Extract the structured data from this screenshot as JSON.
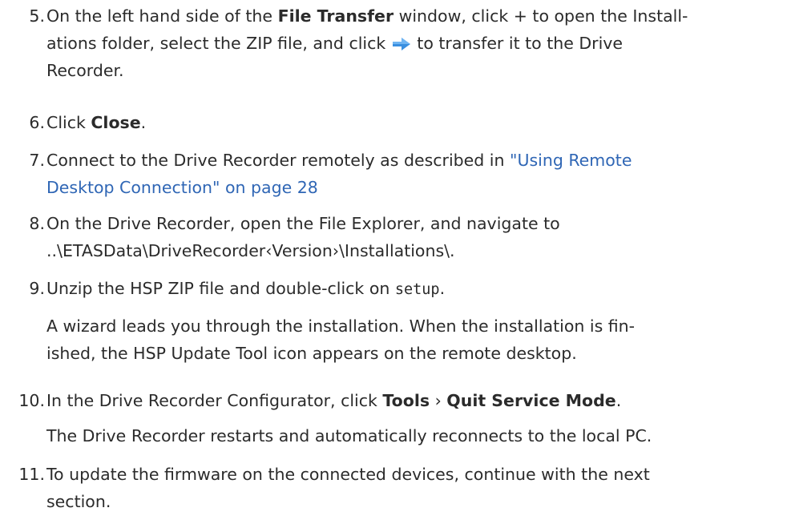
{
  "steps": [
    {
      "number": "5",
      "a": "On the left hand side of the ",
      "b": "File Transfer",
      "c": " window, click + to open the Install-",
      "d": "ations folder, select the ZIP file, and click ",
      "e": " to transfer it to the Drive",
      "f": "Recorder."
    },
    {
      "number": "6",
      "a": "Click ",
      "b": "Close",
      "c": "."
    },
    {
      "number": "7",
      "a": "Connect to the Drive Recorder remotely as described in ",
      "link1": "\"Using Remote",
      "link2": "Desktop Connection\" on page 28"
    },
    {
      "number": "8",
      "line1": "On the Drive Recorder, open the File Explorer, and navigate to",
      "line2": "..\\ETASData\\DriveRecorder‹Version›\\Installations\\."
    },
    {
      "number": "9",
      "a": "Unzip the HSP ZIP file and double-click on ",
      "code": "setup",
      "c": ".",
      "result1": "A wizard leads you through the installation. When the installation is fin-",
      "result2": "ished, the HSP Update Tool icon appears on the remote desktop."
    },
    {
      "number": "10",
      "a": "In the Drive Recorder Configurator, click ",
      "b": "Tools",
      "sep": " › ",
      "c": "Quit Service Mode",
      "d": ".",
      "result": "The Drive Recorder restarts and automatically reconnects to the local PC."
    },
    {
      "number": "11",
      "line1": "To update the firmware on the connected devices, continue with the next",
      "line2": "section."
    }
  ],
  "colors": {
    "text": "#2b2b2b",
    "link": "#2f66b5",
    "arrow": "#3a8fe0"
  },
  "icons": {
    "transfer": "arrow-right-icon"
  }
}
